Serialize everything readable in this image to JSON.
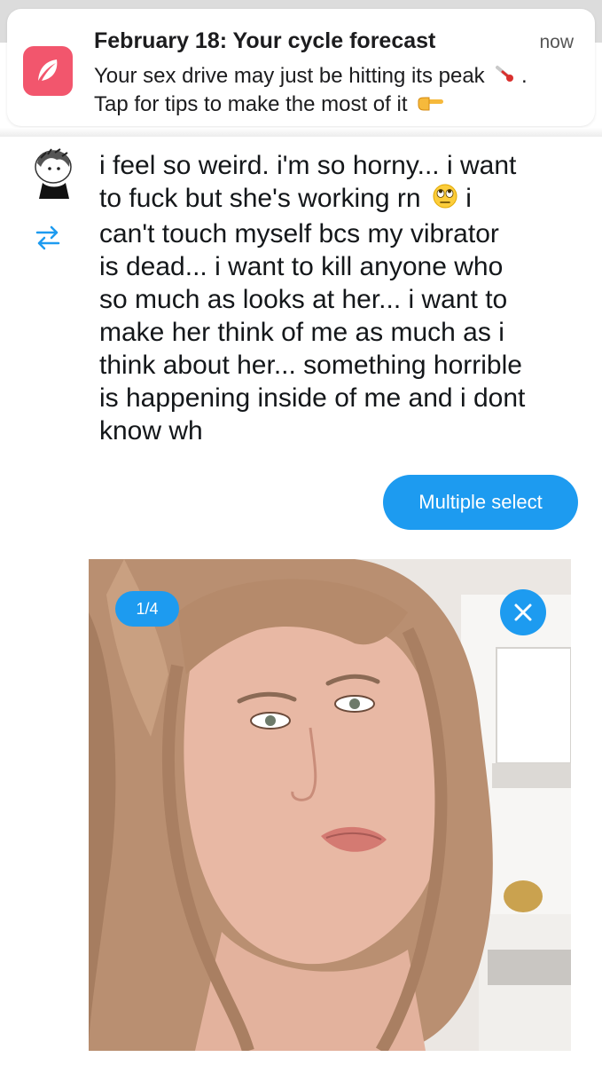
{
  "notification": {
    "title": "February 18: Your cycle forecast",
    "time": "now",
    "line1": "Your sex drive may just be hitting its peak",
    "line2": "Tap for tips to make the most of it",
    "app_icon": "feather-icon",
    "line1_emoji": "thermometer-icon",
    "line2_emoji": "pointing-hand-icon",
    "accent_color": "#f2566d"
  },
  "tweet": {
    "lines": [
      "i feel so weird. i'm so horny... i want",
      "to fuck but she's working rn",
      "can't touch myself bcs my vibrator",
      "is dead... i want to kill anyone who",
      "so much as looks at her... i want to",
      "make her think of me as much as i",
      "think about her... something horrible",
      "is happening inside of me and i dont",
      "know wh"
    ],
    "line2_tail": "i",
    "inline_emoji": "eye-roll-emoji"
  },
  "actions": {
    "multiple_select": "Multiple select"
  },
  "media": {
    "counter": "1/4",
    "close_icon": "close-icon",
    "accent_color": "#1d9bf0"
  }
}
